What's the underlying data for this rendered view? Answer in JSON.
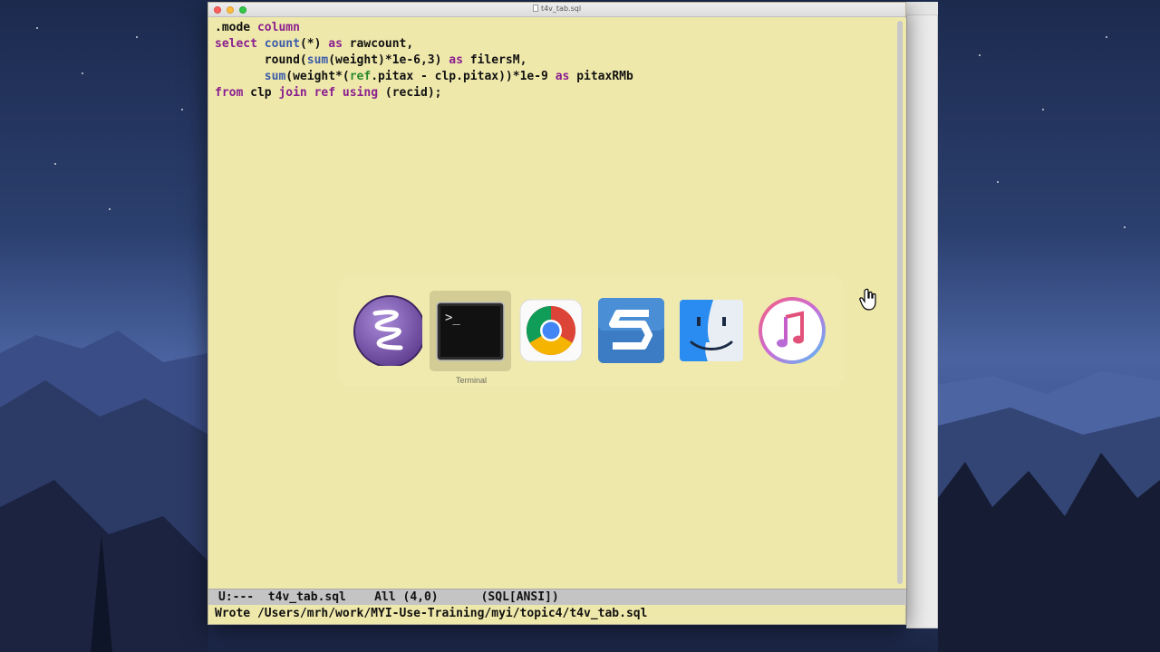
{
  "window": {
    "title": "t4v_tab.sql"
  },
  "editor": {
    "lines": [
      [
        {
          "t": ".mode ",
          "c": ""
        },
        {
          "t": "column",
          "c": "kw"
        }
      ],
      [
        {
          "t": "select ",
          "c": "kw"
        },
        {
          "t": "count",
          "c": "fn"
        },
        {
          "t": "(*) ",
          "c": ""
        },
        {
          "t": "as",
          "c": "kw"
        },
        {
          "t": " rawcount,",
          "c": ""
        }
      ],
      [
        {
          "t": "       round(",
          "c": ""
        },
        {
          "t": "sum",
          "c": "fn"
        },
        {
          "t": "(weight)*1e-6,3) ",
          "c": ""
        },
        {
          "t": "as",
          "c": "kw"
        },
        {
          "t": " filersM,",
          "c": ""
        }
      ],
      [
        {
          "t": "       ",
          "c": ""
        },
        {
          "t": "sum",
          "c": "fn"
        },
        {
          "t": "(weight*(",
          "c": ""
        },
        {
          "t": "ref",
          "c": "tp"
        },
        {
          "t": ".pitax - clp.pitax))*1e-9 ",
          "c": ""
        },
        {
          "t": "as",
          "c": "kw"
        },
        {
          "t": " pitaxRMb",
          "c": ""
        }
      ],
      [
        {
          "t": "from",
          "c": "kw"
        },
        {
          "t": " clp ",
          "c": ""
        },
        {
          "t": "join",
          "c": "kw"
        },
        {
          "t": " ",
          "c": ""
        },
        {
          "t": "ref",
          "c": "kw"
        },
        {
          "t": " ",
          "c": ""
        },
        {
          "t": "using",
          "c": "kw"
        },
        {
          "t": " (recid);",
          "c": ""
        }
      ]
    ]
  },
  "modeline": {
    "text": "U:---  t4v_tab.sql    All (4,0)      (SQL[ANSI])"
  },
  "minibuffer": {
    "text": "Wrote /Users/mrh/work/MYI-Use-Training/myi/topic4/t4v_tab.sql"
  },
  "app_switcher": {
    "apps": [
      {
        "name": "emacs",
        "icon": "emacs-icon"
      },
      {
        "name": "Terminal",
        "icon": "terminal-icon",
        "selected": true
      },
      {
        "name": "chrome",
        "icon": "chrome-icon"
      },
      {
        "name": "snagit",
        "icon": "snagit-icon"
      },
      {
        "name": "finder",
        "icon": "finder-icon"
      },
      {
        "name": "itunes",
        "icon": "itunes-icon"
      }
    ],
    "selected_label": "Terminal"
  },
  "colors": {
    "editor_bg": "#efe8ab",
    "keyword": "#8a1f8f",
    "function": "#3b5ba9",
    "type": "#2e8b2e",
    "modeline_bg": "#c4c4c4"
  }
}
